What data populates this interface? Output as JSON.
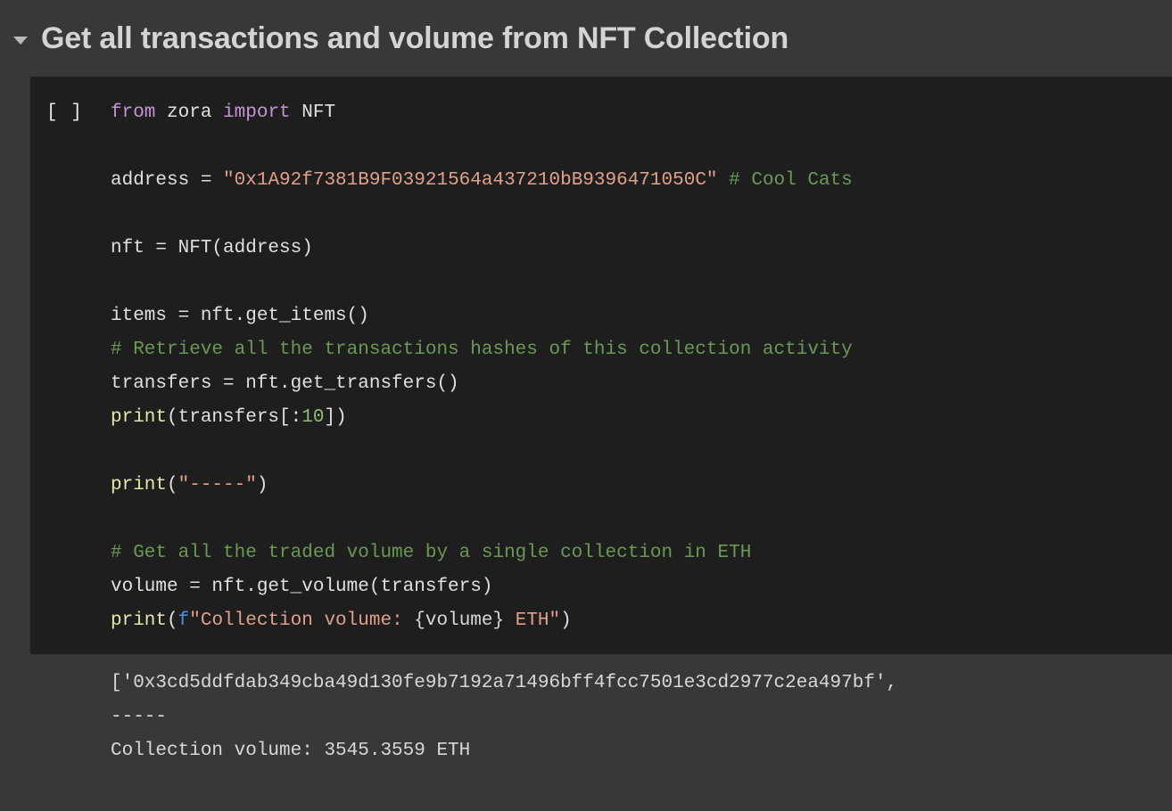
{
  "section": {
    "title": "Get all transactions and volume from NFT Collection",
    "collapse_icon": "caret-down-icon",
    "expanded": true
  },
  "cell": {
    "run_indicator": "[ ]",
    "code_lines": [
      [
        {
          "t": "from",
          "c": "kw"
        },
        {
          "t": " zora ",
          "c": "name"
        },
        {
          "t": "import",
          "c": "kw"
        },
        {
          "t": " NFT",
          "c": "name"
        }
      ],
      [],
      [
        {
          "t": "address = ",
          "c": "name"
        },
        {
          "t": "\"0x1A92f7381B9F03921564a437210bB9396471050C\"",
          "c": "str"
        },
        {
          "t": " ",
          "c": "name"
        },
        {
          "t": "# Cool Cats",
          "c": "com"
        }
      ],
      [],
      [
        {
          "t": "nft = NFT(address)",
          "c": "name"
        }
      ],
      [],
      [
        {
          "t": "items = nft.get_items()",
          "c": "name"
        }
      ],
      [
        {
          "t": "# Retrieve all the transactions hashes of this collection activity",
          "c": "com"
        }
      ],
      [
        {
          "t": "transfers = nft.get_transfers()",
          "c": "name"
        }
      ],
      [
        {
          "t": "print",
          "c": "fn"
        },
        {
          "t": "(transfers[:",
          "c": "name"
        },
        {
          "t": "10",
          "c": "num"
        },
        {
          "t": "])",
          "c": "name"
        }
      ],
      [],
      [
        {
          "t": "print",
          "c": "fn"
        },
        {
          "t": "(",
          "c": "name"
        },
        {
          "t": "\"-----\"",
          "c": "str"
        },
        {
          "t": ")",
          "c": "name"
        }
      ],
      [],
      [
        {
          "t": "# Get all the traded volume by a single collection in ETH",
          "c": "com"
        }
      ],
      [
        {
          "t": "volume = nft.get_volume(transfers)",
          "c": "name"
        }
      ],
      [
        {
          "t": "print",
          "c": "fn"
        },
        {
          "t": "(",
          "c": "name"
        },
        {
          "t": "f",
          "c": "fpre"
        },
        {
          "t": "\"Collection volume: ",
          "c": "str"
        },
        {
          "t": "{volume}",
          "c": "interp"
        },
        {
          "t": " ETH\"",
          "c": "str"
        },
        {
          "t": ")",
          "c": "name"
        }
      ]
    ]
  },
  "output": {
    "lines": [
      "['0x3cd5ddfdab349cba49d130fe9b7192a71496bff4fcc7501e3cd2977c2ea497bf',",
      "-----",
      "Collection volume: 3545.3559 ETH"
    ]
  },
  "colors": {
    "page_background": "#383838",
    "cell_background": "#1e1e1e",
    "title_text": "#d4d4d4",
    "keyword": "#c792d8",
    "string": "#e0a08a",
    "comment": "#6a9955",
    "function": "#e6e6a8",
    "number": "#8fbf72",
    "f_prefix": "#4c91e8",
    "plain_code": "#e0e0e0",
    "output_text": "#d8d8d8"
  }
}
